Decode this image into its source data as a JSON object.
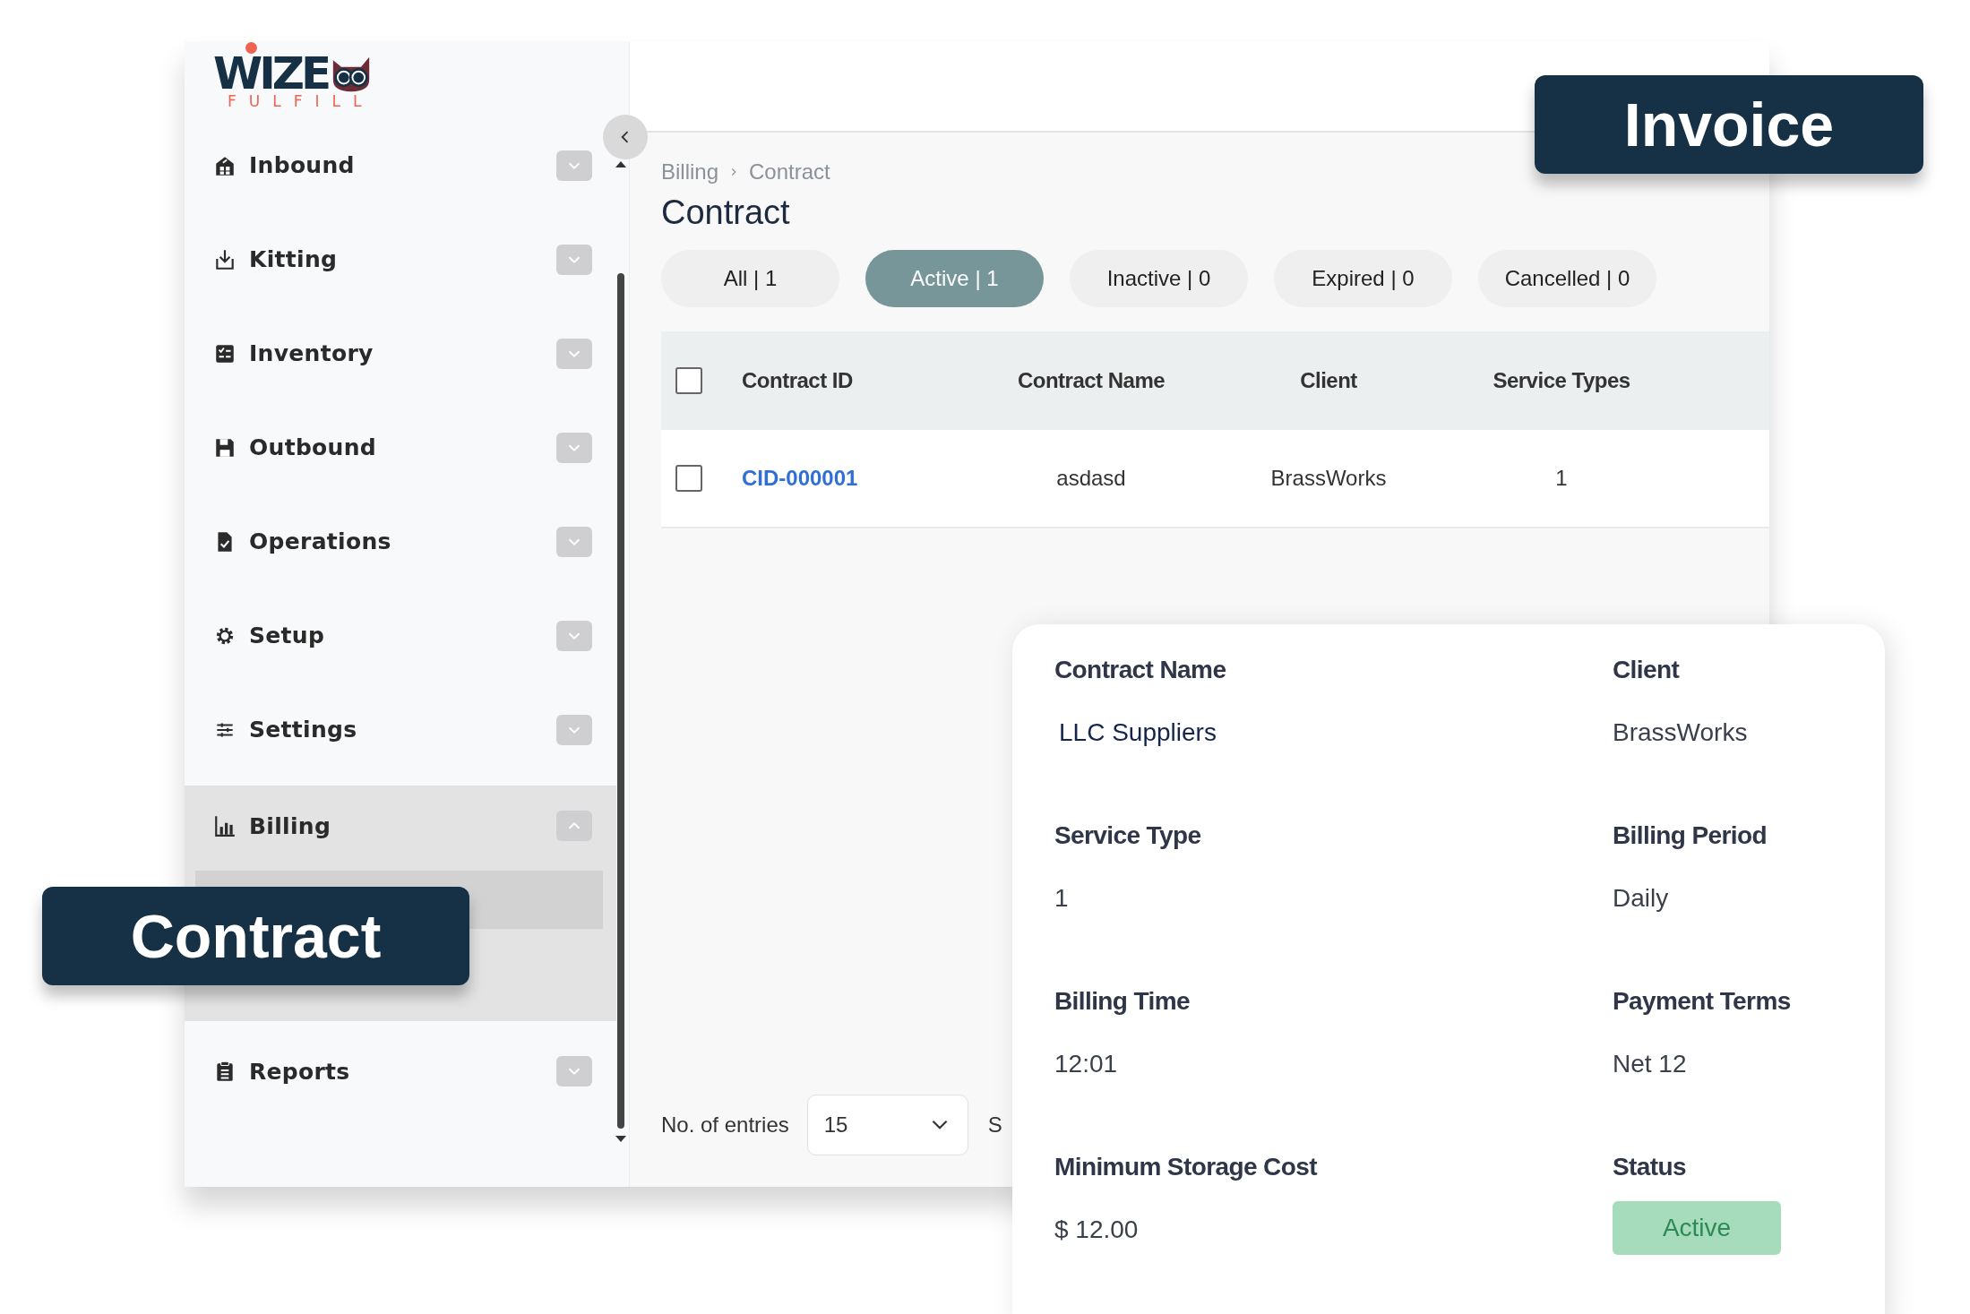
{
  "logo": {
    "wordmark": "WIZE",
    "tagline": "FULFILL"
  },
  "sidebar": {
    "items": [
      {
        "kind": "inbound",
        "label": "Inbound",
        "expanded": false
      },
      {
        "kind": "kitting",
        "label": "Kitting",
        "expanded": false
      },
      {
        "kind": "inventory",
        "label": "Inventory",
        "expanded": false
      },
      {
        "kind": "outbound",
        "label": "Outbound",
        "expanded": false
      },
      {
        "kind": "operations",
        "label": "Operations",
        "expanded": false
      },
      {
        "kind": "setup",
        "label": "Setup",
        "expanded": false
      },
      {
        "kind": "settings",
        "label": "Settings",
        "expanded": false
      },
      {
        "kind": "billing",
        "label": "Billing",
        "expanded": true,
        "children": [
          {
            "selected": true
          }
        ]
      },
      {
        "kind": "reports",
        "label": "Reports",
        "expanded": false
      }
    ]
  },
  "breadcrumb": [
    "Billing",
    "Contract"
  ],
  "title": "Contract",
  "tabs": [
    {
      "label": "All | 1",
      "selected": false
    },
    {
      "label": "Active | 1",
      "selected": true
    },
    {
      "label": "Inactive | 0",
      "selected": false
    },
    {
      "label": "Expired | 0",
      "selected": false
    },
    {
      "label": "Cancelled | 0",
      "selected": false
    }
  ],
  "table": {
    "columns": [
      "Contract ID",
      "Contract Name",
      "Client",
      "Service Types"
    ],
    "header_checked": false,
    "rows": [
      {
        "checked": false,
        "cells": [
          "CID-000001",
          "asdasd",
          "BrassWorks",
          "1"
        ]
      }
    ]
  },
  "footer": {
    "entries_label": "No. of entries",
    "entries_value": "15",
    "column_3": "S"
  },
  "callouts": [
    {
      "text": "Invoice"
    },
    {
      "text": "Contract"
    }
  ],
  "details": {
    "fields": [
      {
        "label": "Contract Name",
        "value": "LLC Suppliers",
        "kind": "name"
      },
      {
        "label": "Client",
        "value": "BrassWorks",
        "kind": "text"
      },
      {
        "label": "Service Type",
        "value": "1",
        "kind": "text"
      },
      {
        "label": "Billing Period",
        "value": "Daily",
        "kind": "text"
      },
      {
        "label": "Billing Time",
        "value": "12:01",
        "kind": "text"
      },
      {
        "label": "Payment Terms",
        "value": "Net 12",
        "kind": "text"
      },
      {
        "label": "Minimum Storage Cost",
        "value": "$ 12.00",
        "kind": "text"
      },
      {
        "label": "Status",
        "value": "Active",
        "kind": "status"
      }
    ]
  }
}
